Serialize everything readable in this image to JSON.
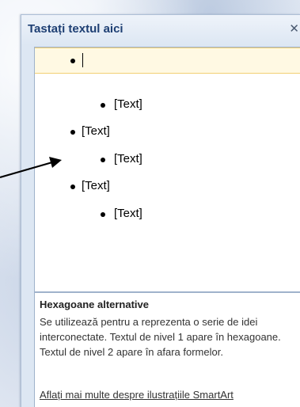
{
  "pane": {
    "title": "Tastați textul aici",
    "close_glyph": "✕"
  },
  "text_pane": {
    "items": [
      {
        "level": 1,
        "text": "",
        "selected": true
      },
      {
        "level": 2,
        "text": "[Text]"
      },
      {
        "level": 1,
        "text": "[Text]"
      },
      {
        "level": 2,
        "text": "[Text]"
      },
      {
        "level": 1,
        "text": "[Text]"
      },
      {
        "level": 2,
        "text": "[Text]"
      }
    ]
  },
  "description": {
    "title": "Hexagoane alternative",
    "body": "Se utilizează pentru a reprezenta o serie de idei interconectate. Textul de nivel 1 apare în hexagoane. Textul de nivel 2 apare în afara formelor.",
    "link": "Aflați mai multe despre ilustrațiile SmartArt"
  },
  "annotation": {
    "arrow_color": "#000000",
    "icon": "pointer-arrow"
  }
}
